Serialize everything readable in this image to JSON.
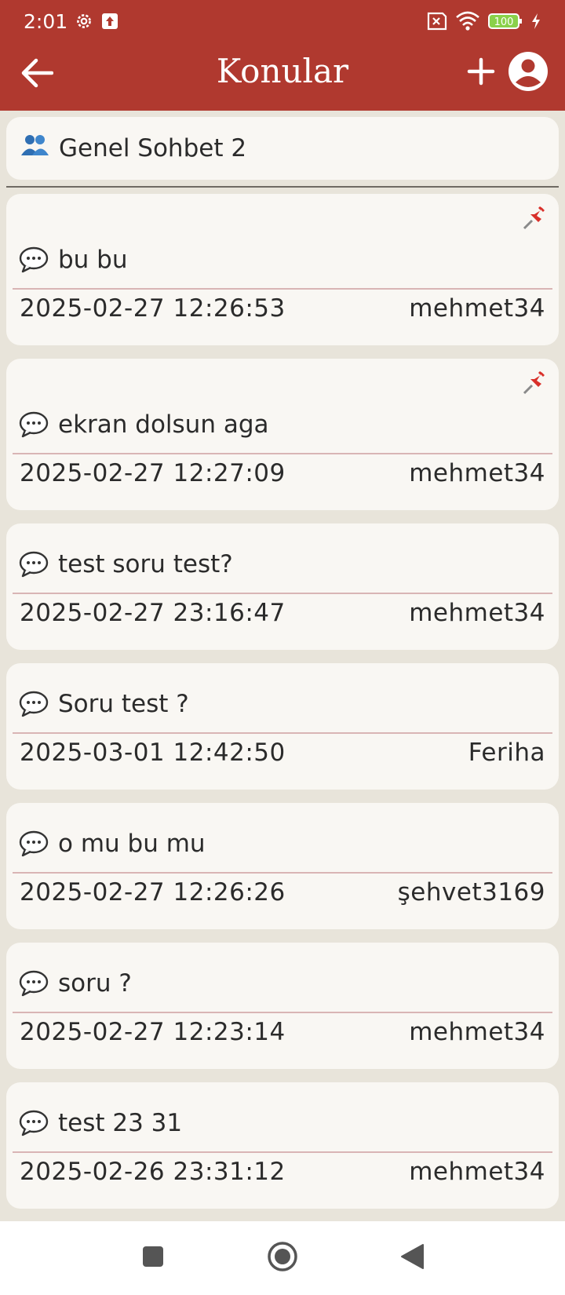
{
  "status": {
    "time": "2:01",
    "battery": "100"
  },
  "appbar": {
    "title": "Konular"
  },
  "group": {
    "name": "Genel Sohbet 2"
  },
  "topics": [
    {
      "title": "bu bu",
      "date": "2025-02-27 12:26:53",
      "author": "mehmet34",
      "pinned": true
    },
    {
      "title": "ekran dolsun aga",
      "date": "2025-02-27 12:27:09",
      "author": "mehmet34",
      "pinned": true
    },
    {
      "title": "test soru test?",
      "date": "2025-02-27 23:16:47",
      "author": "mehmet34",
      "pinned": false
    },
    {
      "title": "Soru test ?",
      "date": "2025-03-01 12:42:50",
      "author": "Feriha",
      "pinned": false
    },
    {
      "title": "o mu bu mu",
      "date": "2025-02-27 12:26:26",
      "author": "şehvet3169",
      "pinned": false
    },
    {
      "title": "soru ?",
      "date": "2025-02-27 12:23:14",
      "author": "mehmet34",
      "pinned": false
    },
    {
      "title": "test 23 31",
      "date": "2025-02-26 23:31:12",
      "author": "mehmet34",
      "pinned": false
    }
  ],
  "colors": {
    "primary": "#b0392f",
    "card": "#f9f7f3",
    "background": "#e8e4da"
  },
  "icons": {
    "back": "arrow-left-icon",
    "add": "plus-icon",
    "profile": "account-circle-icon",
    "group": "people-icon",
    "topic": "speech-bubble-icon",
    "pin": "pushpin-icon"
  }
}
